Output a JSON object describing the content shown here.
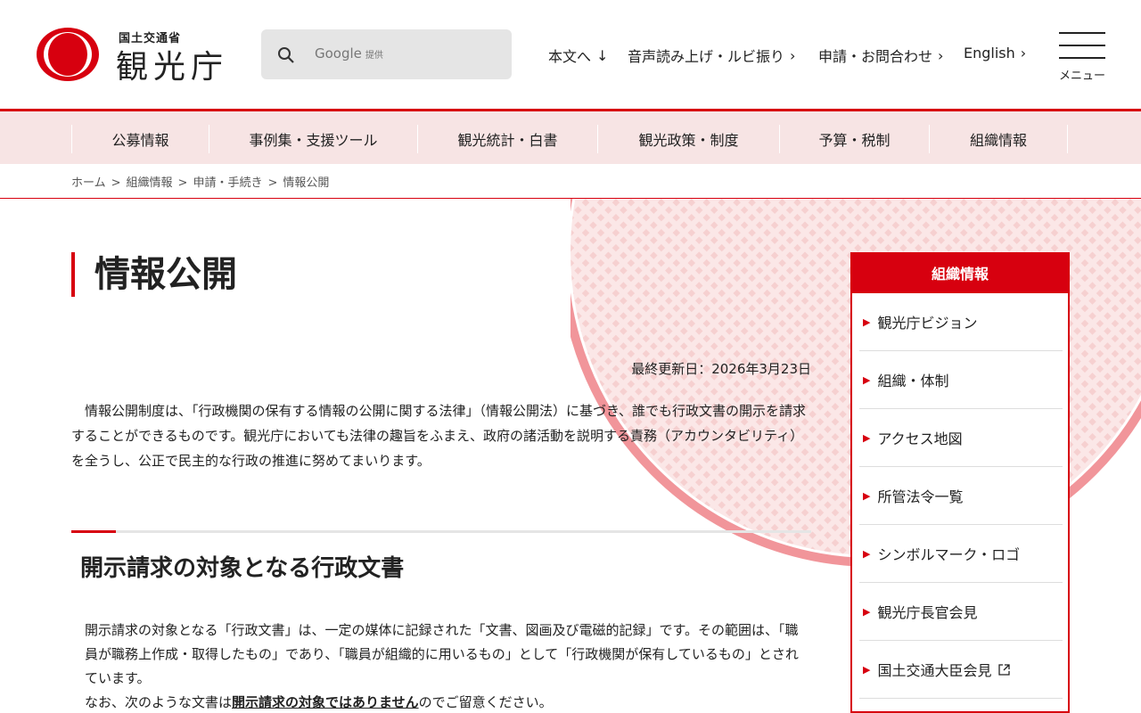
{
  "header": {
    "logo_sub": "国土交通省",
    "logo_main": "観光庁",
    "search_label": "Google",
    "search_suffix": "提供",
    "nav": [
      {
        "label": "本文へ",
        "arrow": "↓"
      },
      {
        "label": "音声読み上げ・ルビ振り",
        "arrow": "›"
      },
      {
        "label": "申請・お問合わせ",
        "arrow": "›"
      },
      {
        "label": "English",
        "arrow": "›"
      }
    ],
    "menu_label": "メニュー"
  },
  "gnav": [
    "公募情報",
    "事例集・支援ツール",
    "観光統計・白書",
    "観光政策・制度",
    "予算・税制",
    "組織情報"
  ],
  "breadcrumb": [
    "ホーム",
    "組織情報",
    "申請・手続き",
    "情報公開"
  ],
  "breadcrumb_sep": ">",
  "main": {
    "title": "情報公開",
    "updated": "最終更新日：2026年3月23日",
    "intro": "情報公開制度は、「行政機関の保有する情報の公開に関する法律」（情報公開法）に基づき、誰でも行政文書の開示を請求することができるものです。観光庁においても法律の趣旨をふまえ、政府の諸活動を説明する責務（アカウンタビリティ）を全うし、公正で民主的な行政の推進に努めてまいります。",
    "section_title": "開示請求の対象となる行政文書",
    "section_p1": "開示請求の対象となる「行政文書」は、一定の媒体に記録された「文書、図画及び電磁的記録」です。その範囲は、「職員が職務上作成・取得したもの」であり、「職員が組織的に用いるもの」として「行政機関が保有しているもの」とされています。",
    "section_p2_pre": "なお、次のような文書は",
    "section_p2_bold": "開示請求の対象ではありません",
    "section_p2_post": "のでご留意ください。"
  },
  "sidebar": {
    "title": "組織情報",
    "items": [
      {
        "label": "観光庁ビジョン",
        "external": false
      },
      {
        "label": "組織・体制",
        "external": false
      },
      {
        "label": "アクセス地図",
        "external": false
      },
      {
        "label": "所管法令一覧",
        "external": false
      },
      {
        "label": "シンボルマーク・ロゴ",
        "external": false
      },
      {
        "label": "観光庁長官会見",
        "external": false
      },
      {
        "label": "国土交通大臣会見",
        "external": true
      }
    ]
  },
  "colors": {
    "accent": "#d7000f",
    "nav_bg": "#f7e4e4"
  },
  "icons": {
    "search": "search-icon",
    "external": "external-link-icon",
    "arrow": "chevron-right-icon"
  }
}
